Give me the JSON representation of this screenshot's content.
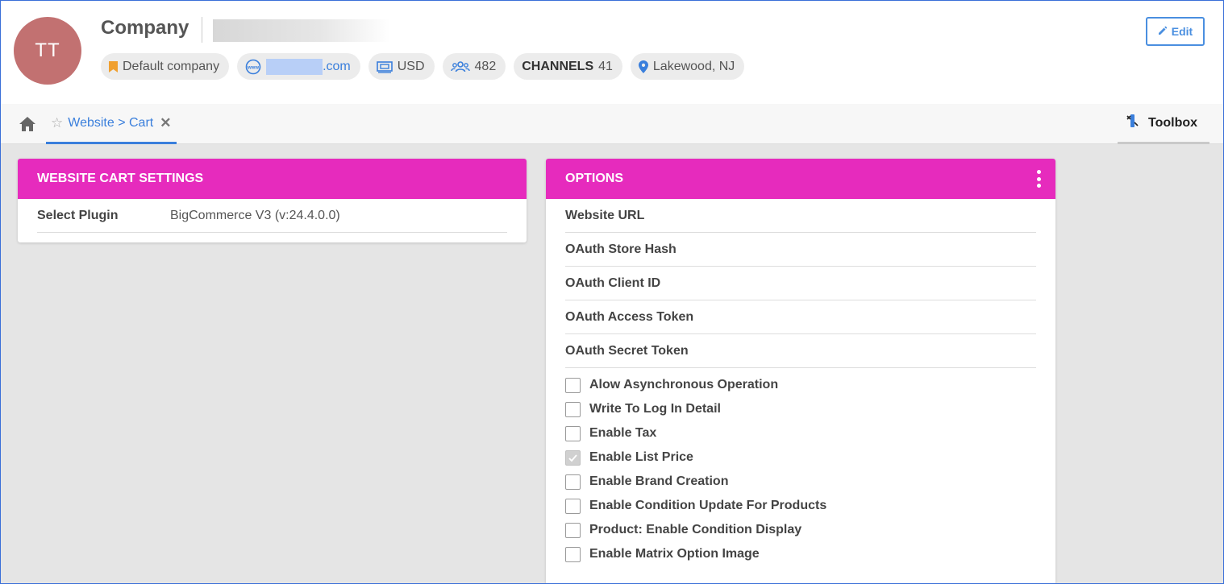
{
  "header": {
    "avatar_initials": "TT",
    "company_name": "Company",
    "edit_label": "Edit",
    "chips": {
      "default_company": "Default company",
      "website_domain": ".com",
      "currency": "USD",
      "contacts_count": "482",
      "channels_label": "CHANNELS",
      "channels_count": "41",
      "location": "Lakewood, NJ"
    }
  },
  "tabs": {
    "active_tab_label": "Website > Cart",
    "toolbox_label": "Toolbox"
  },
  "left_panel": {
    "title": "WEBSITE CART SETTINGS",
    "rows": [
      {
        "key": "Select Plugin",
        "value": "BigCommerce V3 (v:24.4.0.0)"
      }
    ]
  },
  "right_panel": {
    "title": "OPTIONS",
    "fields": [
      "Website URL",
      "OAuth Store Hash",
      "OAuth Client ID",
      "OAuth Access Token",
      "OAuth Secret Token"
    ],
    "checkboxes": [
      {
        "label": "Alow Asynchronous Operation",
        "checked": false
      },
      {
        "label": "Write To Log In Detail",
        "checked": false
      },
      {
        "label": "Enable Tax",
        "checked": false
      },
      {
        "label": "Enable List Price",
        "checked": true
      },
      {
        "label": "Enable Brand Creation",
        "checked": false
      },
      {
        "label": "Enable Condition Update For Products",
        "checked": false
      },
      {
        "label": "Product: Enable Condition Display",
        "checked": false
      },
      {
        "label": "Enable Matrix Option Image",
        "checked": false
      }
    ]
  },
  "colors": {
    "panel_header": "#e62bbd",
    "accent_blue": "#3a7fdc",
    "avatar_bg": "#c27171",
    "bookmark_orange": "#f0a030"
  },
  "icons": [
    "home-icon",
    "star-icon",
    "close-icon",
    "toolbox-icon",
    "pencil-icon",
    "bookmark-icon",
    "www-icon",
    "currency-icon",
    "users-icon",
    "location-pin-icon",
    "kebab-menu-icon",
    "checkmark-icon"
  ]
}
